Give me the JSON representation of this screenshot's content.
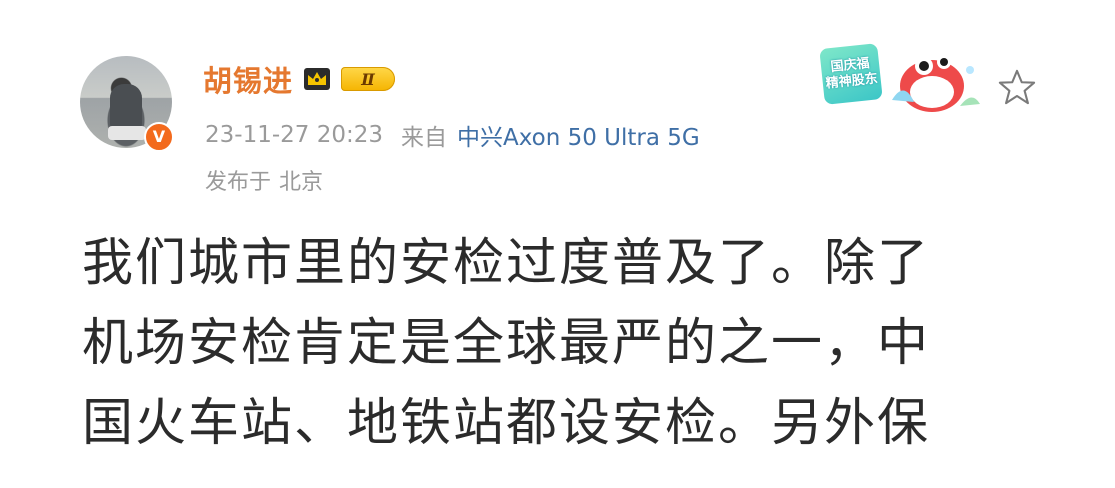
{
  "post": {
    "author": {
      "name": "胡锡进",
      "member_level": "Ⅱ",
      "verified_mark": "V"
    },
    "meta": {
      "timestamp": "23-11-27 20:23",
      "source_prefix": "来自",
      "source_device": "中兴Axon 50 Ultra 5G",
      "location_prefix": "发布于",
      "location": "北京"
    },
    "sticker": {
      "line1": "国庆福",
      "line2": "精神股东"
    },
    "body_lines": [
      "我们城市里的安检过度普及了。除了",
      "机场安检肯定是全球最严的之一，中",
      "国火车站、地铁站都设安检。另外保"
    ]
  },
  "colors": {
    "username": "#e5782f",
    "link": "#3f6fa6",
    "meta": "#9a9a9a",
    "body": "#2b2b2b",
    "verified": "#f36a1d"
  },
  "icons": {
    "crown": "crown-icon",
    "follow": "star-outline-icon",
    "verified": "verified-v-icon"
  }
}
